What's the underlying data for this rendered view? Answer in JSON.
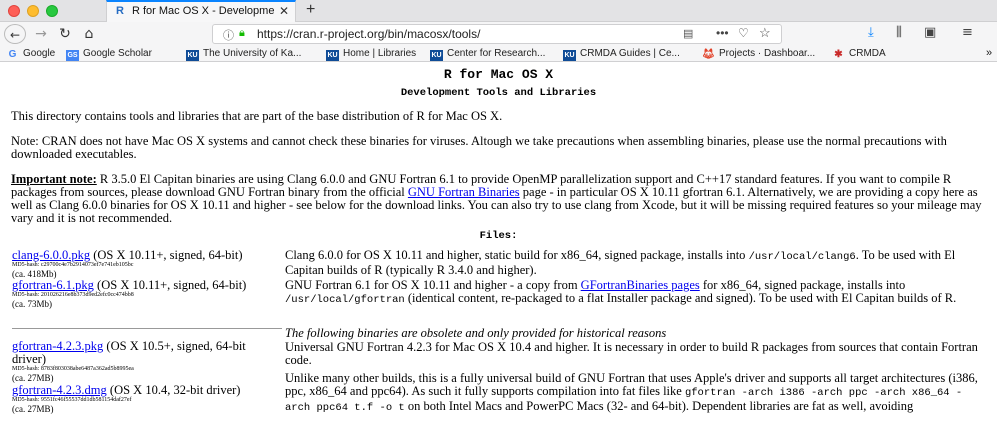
{
  "browser": {
    "tab": {
      "title": "R for Mac OS X - Development",
      "favicon": "R"
    },
    "new_tab_label": "+",
    "url": "https://cran.r-project.org/bin/macosx/tools/",
    "icons": {
      "back": "arrow-left-icon",
      "forward": "arrow-right-icon",
      "reload": "reload-icon",
      "home": "home-icon",
      "info": "info-icon",
      "lock": "lock-icon",
      "reader": "reader-view-icon",
      "more": "more-dots-icon",
      "pocket": "pocket-icon",
      "bookmark": "star-icon",
      "download": "download-icon",
      "library": "library-icon",
      "sidebar": "sidebar-icon",
      "menu": "hamburger-menu-icon"
    },
    "bookmarks": [
      {
        "label": "Google",
        "icon": "G"
      },
      {
        "label": "Google Scholar",
        "icon": "GS"
      },
      {
        "label": "The University of Ka...",
        "icon": "KU"
      },
      {
        "label": "Home | Libraries",
        "icon": "KU"
      },
      {
        "label": "Center for Research...",
        "icon": "KU"
      },
      {
        "label": "CRMDA Guides | Ce...",
        "icon": "KU"
      },
      {
        "label": "Projects · Dashboar...",
        "icon": "fox"
      },
      {
        "label": "CRMDA",
        "icon": "crmda"
      }
    ],
    "bookmarks_more": "»"
  },
  "page": {
    "title": "R for Mac OS X",
    "subtitle": "Development Tools and Libraries",
    "intro": "This directory contains tools and libraries that are part of the base distribution of R for Mac OS X.",
    "note": "Note: CRAN does not have Mac OS X systems and cannot check these binaries for viruses. Altough we take precautions when assembling binaries, please use the normal precautions with downloaded executables.",
    "important": {
      "label": "Important note:",
      "text1": " R 3.5.0 El Capitan binaries are using Clang 6.0.0 and GNU Fortran 6.1 to provide OpenMP parallelization support and C++17 standard features. If you want to compile R packages from sources, please download GNU Fortran binary from the official ",
      "link": "GNU Fortran Binaries",
      "text2": " page - in particular OS X 10.11 gfortran 6.1. Alternatively, we are providing a copy here as well as Clang 6.0.0 binaries for OS X 10.11 and higher - see below for the download links. You can also try to use clang from Xcode, but it will be missing required features so your mileage may vary and it is not recommended."
    },
    "files_heading": "Files:",
    "files": [
      {
        "link": "clang-6.0.0.pkg",
        "info": " (OS X 10.11+, signed, 64-bit)",
        "md5": "MD5-hash: c29700c4e7b2914073ef7e741eb105bc",
        "size": "(ca. 418Mb)",
        "desc_a": "Clang 6.0.0 for OS X 10.11 and higher, static build for x86_64, signed package, installs into ",
        "desc_mono": "/usr/local/clang6",
        "desc_b": ". To be used with El Capitan builds of R (typically R 3.4.0 and higher)."
      },
      {
        "link": "gfortran-6.1.pkg",
        "info": " (OS X 10.11+, signed, 64-bit)",
        "md5": "MD5-hash: 201026216e8b373d9ed2efc0cc474bb8",
        "size": "(ca. 73Mb)",
        "desc_a": "GNU Fortran 6.1 for OS X 10.11 and higher - a copy from ",
        "desc_link": "GFortranBinaries pages",
        "desc_b": " for x86_64, signed package, installs into ",
        "desc_mono": "/usr/local/gfortran",
        "desc_c": " (identical content, re-packaged to a flat Installer package and signed). To be used with El Capitan builds of R."
      },
      {
        "link": "gfortran-4.2.3.pkg",
        "info": " (OS X 10.5+, signed, 64-bit driver)",
        "md5": "MD5-hash: 8783f803038abe6487a362ad5b8995ea",
        "size": "(ca. 27MB)",
        "desc": "Universal GNU Fortran 4.2.3 for Mac OS X 10.4 and higher. It is necessary in order to build R packages from sources that contain Fortran code."
      },
      {
        "link": "gfortran-4.2.3.dmg",
        "info": " (OS X 10.4, 32-bit driver)",
        "md5": "MD5-hash: 9551fc46f55537dd1db581154daf27ef",
        "size": "(ca. 27MB)",
        "desc_a": "Unlike many other builds, this is a fully universal build of GNU Fortran that uses Apple's driver and supports all target architectures (i386, ppc, x86_64 and ppc64). As such it fully supports compilation into fat files like ",
        "desc_mono": "gfortran -arch i386 -arch ppc -arch x86_64 -arch ppc64 t.f -o t",
        "desc_b": " on both Intel Macs and PowerPC Macs (32- and 64-bit). Dependent libraries are fat as well, avoiding"
      }
    ],
    "obsolete_note": "The following binaries are obsolete and only provided for historical reasons"
  }
}
